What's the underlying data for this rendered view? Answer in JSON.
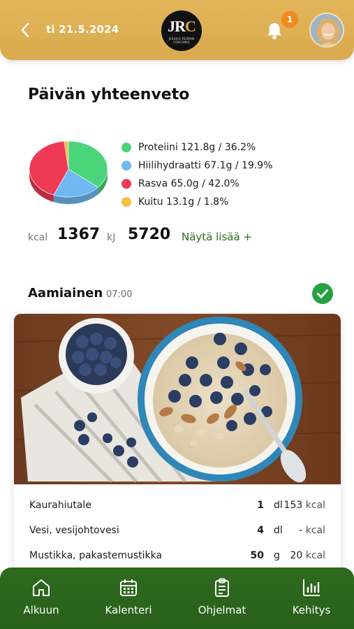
{
  "header": {
    "date": "ti 21.5.2024",
    "logo_mark_left": "JR",
    "logo_mark_right": "C",
    "logo_sub": "JESSICA REIMAN COACHING",
    "notification_count": "1",
    "back_icon": "chevron-left-icon",
    "bell_icon": "bell-icon"
  },
  "summary": {
    "title": "Päivän yhteenveto",
    "legend": [
      {
        "label": "Proteiini 121.8g / 36.2%",
        "color": "#4cd47a"
      },
      {
        "label": "Hiilihydraatti 67.1g / 19.9%",
        "color": "#70b8f2"
      },
      {
        "label": "Rasva 65.0g / 42.0%",
        "color": "#ee3a55"
      },
      {
        "label": "Kuitu 13.1g / 1.8%",
        "color": "#f4c04a"
      }
    ],
    "kcal_unit": "kcal",
    "kcal_value": "1367",
    "kj_unit": "kJ",
    "kj_value": "5720",
    "more_label": "Näytä lisää +"
  },
  "chart_data": {
    "type": "pie",
    "categories": [
      "Proteiini",
      "Hiilihydraatti",
      "Rasva",
      "Kuitu"
    ],
    "values": [
      36.2,
      19.9,
      42.0,
      1.8
    ],
    "grams": [
      121.8,
      67.1,
      65.0,
      13.1
    ],
    "colors": [
      "#4cd47a",
      "#70b8f2",
      "#ee3a55",
      "#f4c04a"
    ],
    "title": "",
    "legend_position": "right"
  },
  "meal": {
    "title": "Aamiainen",
    "time": "07:00",
    "completed_icon": "checkmark-icon",
    "ingredients": [
      {
        "name": "Kaurahiutale",
        "amount": "1",
        "unit": "dl",
        "kcal": "153",
        "kcal_unit": "kcal"
      },
      {
        "name": "Vesi, vesijohtovesi",
        "amount": "4",
        "unit": "dl",
        "kcal": "-",
        "kcal_unit": "kcal"
      },
      {
        "name": "Mustikka, pakastemustikka",
        "amount": "50",
        "unit": "g",
        "kcal": "20",
        "kcal_unit": "kcal"
      }
    ]
  },
  "nav": {
    "items": [
      {
        "label": "Alkuun",
        "icon": "home-icon"
      },
      {
        "label": "Kalenteri",
        "icon": "calendar-icon"
      },
      {
        "label": "Ohjelmat",
        "icon": "clipboard-icon"
      },
      {
        "label": "Kehitys",
        "icon": "bar-chart-icon"
      }
    ]
  }
}
